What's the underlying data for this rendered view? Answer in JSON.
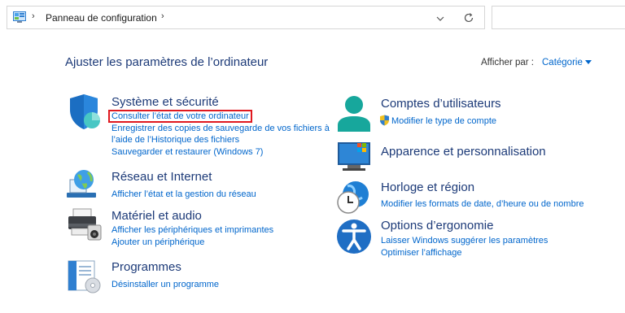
{
  "address": {
    "breadcrumb": "Panneau de configuration",
    "sep1": "›",
    "sep2": "›"
  },
  "header": {
    "title": "Ajuster les paramètres de l’ordinateur",
    "view_by_label": "Afficher par :",
    "view_by_value": "Catégorie"
  },
  "categories_left": [
    {
      "title": "Système et sécurité",
      "links": [
        "Consulter l’état de votre ordinateur",
        "Enregistrer des copies de sauvegarde de vos fichiers à",
        "l’aide de l’Historique des fichiers",
        "Sauvegarder et restaurer (Windows 7)"
      ]
    },
    {
      "title": "Réseau et Internet",
      "links": [
        "Afficher l’état et la gestion du réseau"
      ]
    },
    {
      "title": "Matériel et audio",
      "links": [
        "Afficher les périphériques et imprimantes",
        "Ajouter un périphérique"
      ]
    },
    {
      "title": "Programmes",
      "links": [
        "Désinstaller un programme"
      ]
    }
  ],
  "categories_right": [
    {
      "title": "Comptes d’utilisateurs",
      "links": [
        "Modifier le type de compte"
      ]
    },
    {
      "title": "Apparence et personnalisation",
      "links": []
    },
    {
      "title": "Horloge et région",
      "links": [
        "Modifier les formats de date, d’heure ou de nombre"
      ]
    },
    {
      "title": "Options d’ergonomie",
      "links": [
        "Laisser Windows suggérer les paramètres",
        "Optimiser l’affichage"
      ]
    }
  ],
  "colors": {
    "heading": "#1c3a78",
    "link": "#0066cc",
    "highlight": "#e0191f"
  }
}
